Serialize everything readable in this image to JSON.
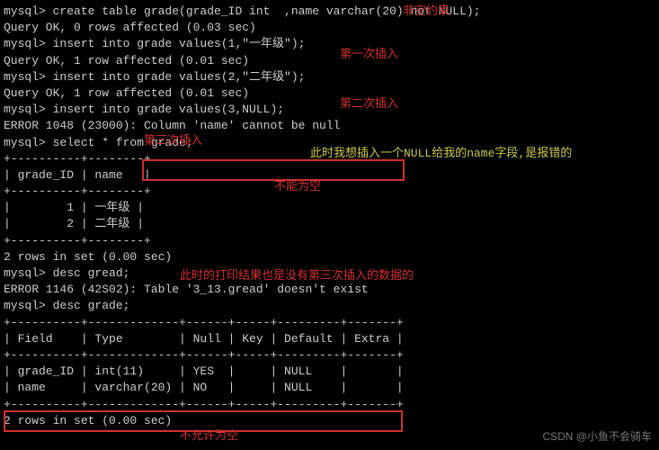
{
  "lines": {
    "l1": "mysql> create table grade(grade_ID int  ,name varchar(20) not NULL);",
    "l2": "Query OK, 0 rows affected (0.03 sec)",
    "l3": "",
    "l4": "mysql> insert into grade values(1,\"一年级\");",
    "l5": "Query OK, 1 row affected (0.01 sec)",
    "l6": "",
    "l7": "mysql> insert into grade values(2,\"二年级\");",
    "l8": "Query OK, 1 row affected (0.01 sec)",
    "l9": "",
    "l10": "mysql> insert into grade values(3,NULL);",
    "l11": "ERROR 1048 (23000): Column 'name' cannot be null",
    "l12": "mysql> select * from grade;",
    "l13": "+----------+--------+",
    "l14": "| grade_ID | name   |",
    "l15": "+----------+--------+",
    "l16": "|        1 | 一年级 |",
    "l17": "|        2 | 二年级 |",
    "l18": "+----------+--------+",
    "l19": "2 rows in set (0.00 sec)",
    "l20": "",
    "l21": "mysql> desc gread;",
    "l22": "ERROR 1146 (42S02): Table '3_13.gread' doesn't exist",
    "l23": "mysql> desc grade;",
    "l24": "+----------+-------------+------+-----+---------+-------+",
    "l25": "| Field    | Type        | Null | Key | Default | Extra |",
    "l26": "+----------+-------------+------+-----+---------+-------+",
    "l27": "| grade_ID | int(11)     | YES  |     | NULL    |       |",
    "l28": "| name     | varchar(20) | NO   |     | NULL    |       |",
    "l29": "+----------+-------------+------+-----+---------+-------+",
    "l30": "2 rows in set (0.00 sec)"
  },
  "notes": {
    "non_null": "非空约束",
    "insert1": "第一次插入",
    "insert2": "第二次插入",
    "insert3": "第三次插入",
    "want_null": "此时我想插入一个NULL给我的name字段,是报错的",
    "cannot_null": "不能为空",
    "print_result": "此时的打印结果也是没有第三次插入的数据的",
    "not_allow_null": "不允许为空"
  },
  "watermark": "CSDN @小鱼不会骑车"
}
